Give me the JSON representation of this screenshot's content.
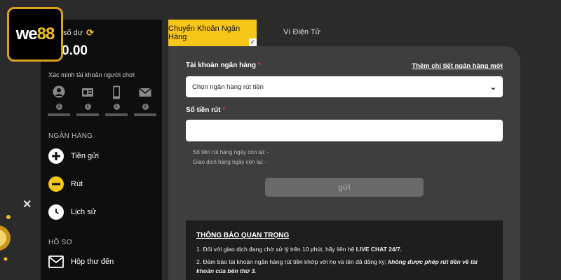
{
  "logo": {
    "text_main": "we",
    "text_accent": "88"
  },
  "sidebar": {
    "balance_label": "số dư",
    "balance_value": "0.00",
    "verify_label": "Xác minh tài khoản người chơi",
    "verify_icons": [
      "user-icon",
      "id-card-icon",
      "phone-icon",
      "mail-icon"
    ],
    "bank_section": "NGÂN HÀNG",
    "nav": [
      {
        "label": "Tiền gửi",
        "icon": "plus-icon"
      },
      {
        "label": "Rút",
        "icon": "minus-icon"
      },
      {
        "label": "Lịch sử",
        "icon": "clock-icon"
      }
    ],
    "profile_section": "HỒ SƠ",
    "inbox_label": "Hộp thư đến"
  },
  "tabs": {
    "active": "Chuyển Khoản Ngân Hàng",
    "inactive": "Ví Điện Tử"
  },
  "form": {
    "bank_label": "Tài khoản ngân hàng",
    "add_bank_link": "Thêm chi tiết ngân hàng mới",
    "bank_select_value": "Chọn ngân hàng rút tiền",
    "amount_label": "Số tiền rút",
    "amount_value": "",
    "remaining_label": "Số tiền rút hàng ngày còn lại: -",
    "remaining_tx_label": "Giao dịch hàng ngày còn lại: -",
    "submit_label": "gửi"
  },
  "notice": {
    "title": "THÔNG BÁO QUAN TRỌNG",
    "item1_prefix": "1. Đối với giao dịch đang chờ xử lý trên 10 phút, hãy liên hệ ",
    "item1_bold": "LIVE CHAT 24/7.",
    "item2_prefix": "2. Đảm bảo tài khoản ngân hàng rút tiền khớp với họ và tên đã đăng ký; ",
    "item2_bold": "không được phép rút tiền về tài khoản của bên thứ 3."
  },
  "colors": {
    "accent": "#f5c518",
    "panel": "#3e3e3e",
    "sidebar": "#0e0e0e"
  }
}
